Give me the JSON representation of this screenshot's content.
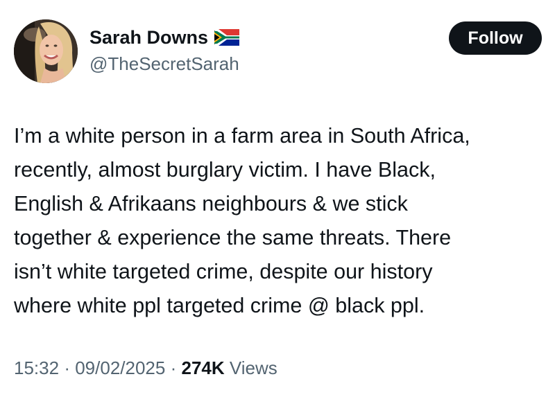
{
  "author": {
    "display_name": "Sarah Downs",
    "handle": "@TheSecretSarah",
    "flag_icon": "south-africa-flag-icon"
  },
  "follow_label": "Follow",
  "tweet": {
    "lines": [
      "I’m a white person in a farm area in South Africa,",
      "recently, almost burglary victim. I have Black,",
      "English & Afrikaans neighbours & we stick",
      "together & experience the same threats. There",
      "isn’t  white targeted crime, despite our history",
      "where white ppl targeted crime @ black ppl."
    ]
  },
  "meta": {
    "time": "15:32",
    "separator": "·",
    "date": "09/02/2025",
    "views_count": "274K",
    "views_label": "Views"
  },
  "colors": {
    "text": "#0f1419",
    "secondary": "#536471",
    "button_bg": "#0f1419",
    "button_text": "#ffffff"
  }
}
